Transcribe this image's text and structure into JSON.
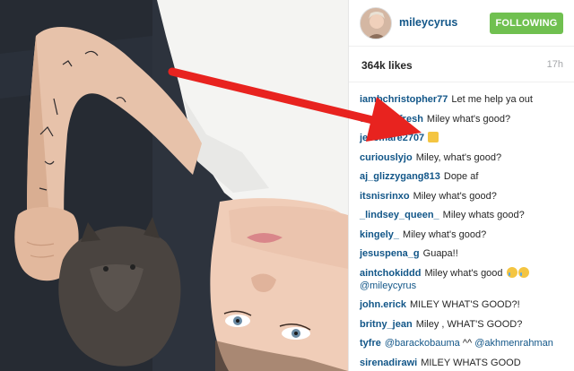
{
  "post": {
    "username": "mileycyrus",
    "follow_label": "FOLLOWING",
    "likes": "364k likes",
    "time": "17h"
  },
  "comments": [
    {
      "user": "iambchristopher77",
      "text": "Let me help ya out"
    },
    {
      "user": "davinci_fresh",
      "text": "Miley what's good?"
    },
    {
      "user": "jessmare2707",
      "text": "",
      "emoji": "thumbs-up"
    },
    {
      "user": "curiouslyjo",
      "text": "Miley, what's good?"
    },
    {
      "user": "aj_glizzygang813",
      "text": "Dope af"
    },
    {
      "user": "itsnisrinxo",
      "text": "Miley what's good?"
    },
    {
      "user": "_lindsey_queen_",
      "text": "Miley whats good?"
    },
    {
      "user": "kingely_",
      "text": "Miley what's good?"
    },
    {
      "user": "jesuspena_g",
      "text": "Guapa!!"
    },
    {
      "user": "aintchokiddd",
      "text": "Miley what's good",
      "emoji": "crying-laughing",
      "mention": "@mileycyrus"
    },
    {
      "user": "john.erick",
      "text": "MILEY WHAT'S GOOD?!"
    },
    {
      "user": "britny_jean",
      "text": "Miley , WHAT'S GOOD?"
    },
    {
      "user": "tyfre",
      "text": "^^",
      "mention": "@barackobauma",
      "mention2": "@akhmenrahman"
    },
    {
      "user": "sirenadirawi",
      "text": "MILEY WHATS GOOD"
    }
  ],
  "colors": {
    "link": "#125688",
    "follow_bg": "#70c050",
    "arrow": "#e8231f"
  }
}
